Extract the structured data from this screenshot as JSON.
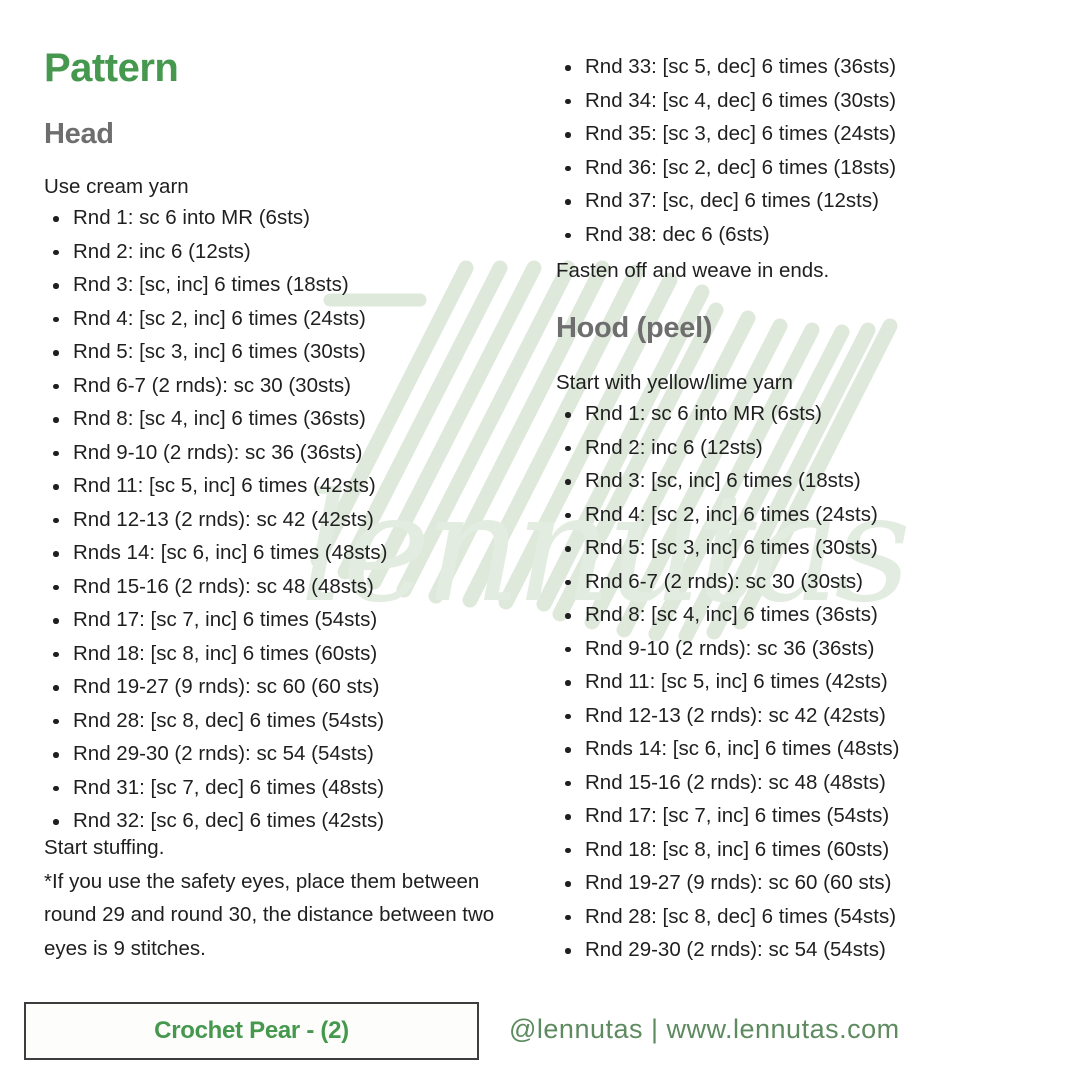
{
  "document": {
    "title": "Pattern",
    "accent_green": "#45984d",
    "heading_gray": "#6e6e6e",
    "body_black": "#1f1f1f",
    "watermark_green": "#dfe9db",
    "footer_green": "#5d8a5f",
    "background": "#ffffff"
  },
  "sections": {
    "head": {
      "heading": "Head",
      "intro": "Use cream yarn",
      "rounds_left": [
        "Rnd 1: sc 6 into MR (6sts)",
        "Rnd 2: inc 6 (12sts)",
        "Rnd 3: [sc, inc] 6 times (18sts)",
        "Rnd 4: [sc 2, inc] 6 times (24sts)",
        "Rnd 5: [sc 3, inc] 6 times (30sts)",
        "Rnd 6-7 (2 rnds): sc 30 (30sts)",
        "Rnd 8: [sc 4, inc] 6 times (36sts)",
        "Rnd 9-10 (2 rnds): sc 36 (36sts)",
        "Rnd 11: [sc 5, inc] 6 times (42sts)",
        "Rnd 12-13 (2 rnds): sc 42 (42sts)",
        "Rnds 14: [sc 6, inc] 6 times (48sts)",
        "Rnd 15-16 (2 rnds): sc 48 (48sts)",
        "Rnd 17: [sc 7, inc] 6 times (54sts)",
        "Rnd 18: [sc 8, inc] 6 times (60sts)",
        "Rnd 19-27 (9 rnds): sc 60 (60 sts)",
        "Rnd 28: [sc 8, dec] 6 times (54sts)",
        "Rnd 29-30 (2 rnds): sc 54 (54sts)",
        "Rnd 31: [sc 7, dec] 6 times (48sts)",
        "Rnd 32: [sc 6, dec] 6 times (42sts)"
      ],
      "note_start_stuffing": "Start stuffing.",
      "note_safety_eyes": "*If you use the safety eyes, place them between round 29 and round 30, the distance between two eyes is 9 stitches.",
      "rounds_right": [
        "Rnd 33: [sc 5, dec] 6 times (36sts)",
        "Rnd 34: [sc 4, dec] 6 times (30sts)",
        "Rnd 35: [sc 3, dec] 6 times (24sts)",
        "Rnd 36: [sc 2, dec] 6 times (18sts)",
        "Rnd 37: [sc, dec] 6 times (12sts)",
        "Rnd 38: dec 6 (6sts)"
      ],
      "fasten_off": "Fasten off and weave in ends."
    },
    "hood": {
      "heading": "Hood (peel)",
      "intro": "Start with yellow/lime yarn",
      "rounds": [
        "Rnd 1: sc 6 into MR (6sts)",
        "Rnd 2: inc 6 (12sts)",
        "Rnd 3: [sc, inc] 6 times (18sts)",
        "Rnd 4: [sc 2, inc] 6 times (24sts)",
        "Rnd 5: [sc 3, inc] 6 times (30sts)",
        "Rnd 6-7 (2 rnds): sc 30 (30sts)",
        "Rnd 8: [sc 4, inc] 6 times (36sts)",
        "Rnd 9-10 (2 rnds): sc 36 (36sts)",
        "Rnd 11: [sc 5, inc] 6 times (42sts)",
        "Rnd 12-13 (2 rnds): sc 42 (42sts)",
        "Rnds 14: [sc 6, inc] 6 times (48sts)",
        "Rnd 15-16 (2 rnds): sc 48 (48sts)",
        "Rnd 17: [sc 7, inc] 6 times (54sts)",
        "Rnd 18: [sc 8, inc] 6 times (60sts)",
        "Rnd 19-27 (9 rnds): sc 60 (60 sts)",
        "Rnd 28: [sc 8, dec] 6 times (54sts)",
        "Rnd 29-30 (2 rnds): sc 54 (54sts)"
      ]
    }
  },
  "watermark": {
    "script_text": "lennutas"
  },
  "footer": {
    "pattern_name": "Crochet Pear - (2)",
    "handle": "@lennutas | www.lennutas.com"
  }
}
